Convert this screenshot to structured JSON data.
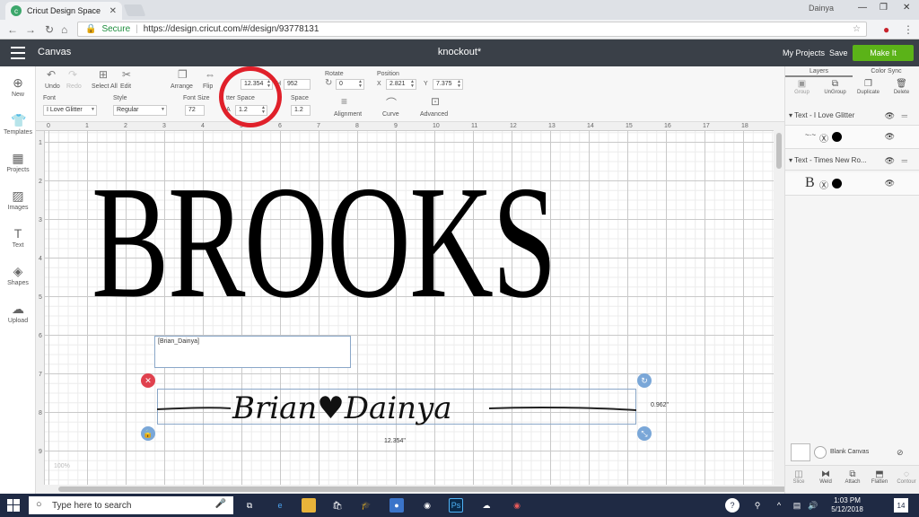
{
  "browser": {
    "tab_title": "Cricut Design Space",
    "user": "Dainya",
    "secure_label": "Secure",
    "url": "https://design.cricut.com/#/design/93778131"
  },
  "header": {
    "app_name": "Canvas",
    "doc_title": "knockout*",
    "my_projects": "My Projects",
    "save": "Save",
    "make_it": "Make It"
  },
  "sidebar": {
    "items": [
      {
        "label": "New",
        "icon": "plus-icon"
      },
      {
        "label": "Templates",
        "icon": "shirt-icon"
      },
      {
        "label": "Projects",
        "icon": "projects-icon"
      },
      {
        "label": "Images",
        "icon": "image-icon"
      },
      {
        "label": "Text",
        "icon": "text-icon"
      },
      {
        "label": "Shapes",
        "icon": "shapes-icon"
      },
      {
        "label": "Upload",
        "icon": "upload-icon"
      }
    ]
  },
  "toolbar": {
    "undo": "Undo",
    "redo": "Redo",
    "select_all": "Select All",
    "edit": "Edit",
    "arrange": "Arrange",
    "flip": "Flip",
    "width_value": "12.354",
    "h_label": "H",
    "height_value": "952",
    "rotate_label": "Rotate",
    "rotate_value": "0",
    "position_label": "Position",
    "x_label": "X",
    "x_value": "2.821",
    "y_label": "Y",
    "y_value": "7.375",
    "font_label": "Font",
    "font_value": "I Love Glitter",
    "style_label": "Style",
    "style_value": "Regular",
    "font_size_label": "Font Size",
    "font_size_value": "72",
    "letter_space_label": "tter Space",
    "letter_space_value": "1.2",
    "line_space_label": "Space",
    "line_space_value": "1.2",
    "alignment": "Alignment",
    "curve": "Curve",
    "advanced": "Advanced"
  },
  "ruler": {
    "h": [
      "0",
      "1",
      "2",
      "3",
      "4",
      "5",
      "6",
      "7",
      "8",
      "9",
      "10",
      "11",
      "12",
      "13",
      "14",
      "15",
      "16",
      "17",
      "18"
    ],
    "v": [
      "1",
      "2",
      "3",
      "4",
      "5",
      "6",
      "7",
      "8",
      "9"
    ]
  },
  "canvas": {
    "big_text": "BROOKS",
    "textbox_value": "[Brian_Dainya]",
    "script_text": "Brian♥Dainya",
    "width_dim": "12.354\"",
    "height_dim": "0.962\"",
    "zoom_label": "100%"
  },
  "layers": {
    "tab_layers": "Layers",
    "tab_colorsync": "Color Sync",
    "group": "Group",
    "ungroup": "UnGroup",
    "duplicate": "Duplicate",
    "delete": "Delete",
    "layer1_name": "Text - I Love Glitter",
    "layer2_name": "Text - Times New Ro...",
    "layer2_letter": "B",
    "blank_canvas": "Blank Canvas",
    "slice": "Slice",
    "weld": "Weld",
    "attach": "Attach",
    "flatten": "Flatten",
    "contour": "Contour"
  },
  "taskbar": {
    "search_placeholder": "Type here to search",
    "time": "1:03 PM",
    "date": "5/12/2018",
    "notif_count": "14"
  }
}
